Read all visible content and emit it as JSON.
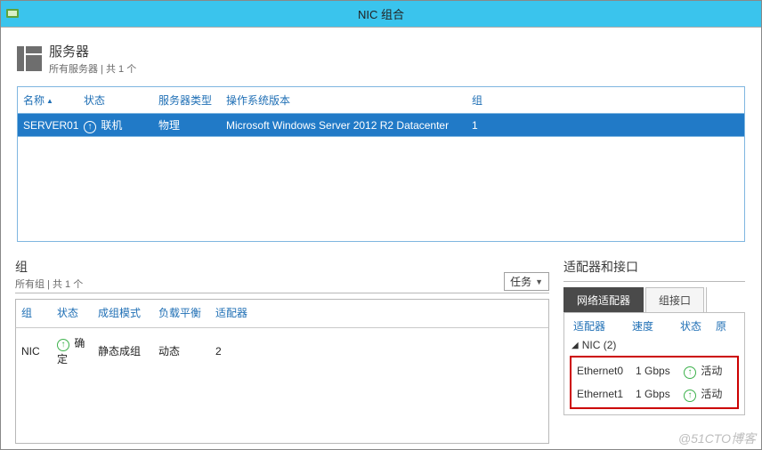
{
  "title": "NIC 组合",
  "servers": {
    "heading": "服务器",
    "sub": "所有服务器 | 共 1 个",
    "columns": {
      "name": "名称",
      "status": "状态",
      "type": "服务器类型",
      "os": "操作系统版本",
      "team": "组"
    },
    "row": {
      "name": "SERVER01",
      "status": "联机",
      "type": "物理",
      "os": "Microsoft Windows Server 2012 R2 Datacenter",
      "team": "1"
    }
  },
  "groups": {
    "heading": "组",
    "sub": "所有组 | 共 1 个",
    "tasks": "任务",
    "columns": {
      "team": "组",
      "status": "状态",
      "mode": "成组模式",
      "lb": "负载平衡",
      "adapters": "适配器"
    },
    "row": {
      "team": "NIC",
      "status": "确定",
      "mode": "静态成组",
      "lb": "动态",
      "adapters": "2"
    }
  },
  "adapters": {
    "heading": "适配器和接口",
    "tabs": {
      "netadapter": "网络适配器",
      "teamiface": "组接口"
    },
    "columns": {
      "adapter": "适配器",
      "speed": "速度",
      "state": "状态",
      "reason": "原"
    },
    "groupline": "NIC (2)",
    "rows": [
      {
        "adapter": "Ethernet0",
        "speed": "1 Gbps",
        "state": "活动"
      },
      {
        "adapter": "Ethernet1",
        "speed": "1 Gbps",
        "state": "活动"
      }
    ]
  },
  "watermark": "@51CTO博客"
}
